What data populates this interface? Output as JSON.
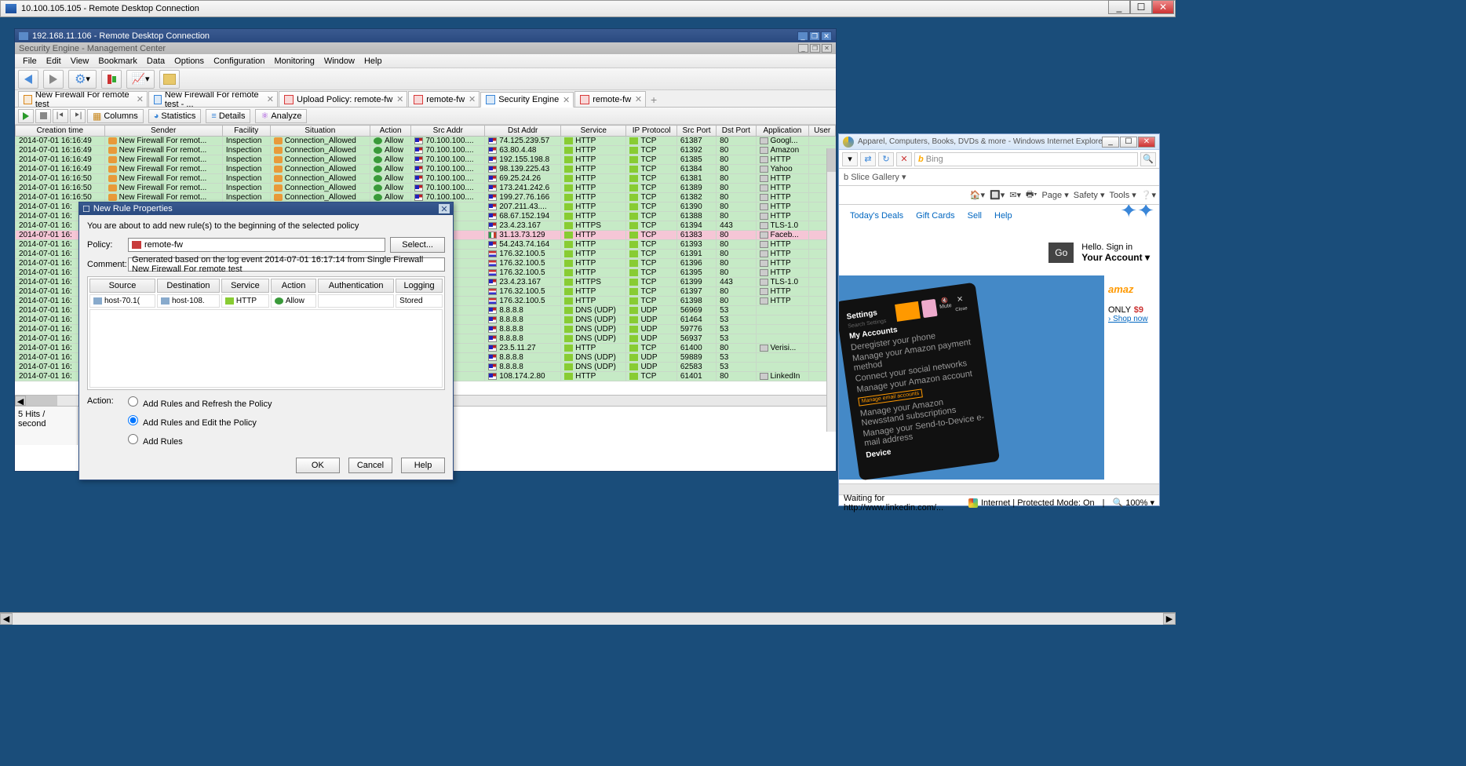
{
  "outer_rdp": {
    "title": "10.100.105.105 - Remote Desktop Connection"
  },
  "inner_rdp": {
    "title": "192.168.11.106 - Remote Desktop Connection"
  },
  "sec_win": {
    "title": "Security Engine - Management Center"
  },
  "menu": [
    "File",
    "Edit",
    "View",
    "Bookmark",
    "Data",
    "Options",
    "Configuration",
    "Monitoring",
    "Window",
    "Help"
  ],
  "tabs": [
    {
      "label": "New Firewall For remote test",
      "icon": "orange"
    },
    {
      "label": "New Firewall For remote test - ...",
      "icon": "blue"
    },
    {
      "label": "Upload Policy: remote-fw",
      "icon": "red"
    },
    {
      "label": "remote-fw",
      "icon": "red"
    },
    {
      "label": "Security Engine",
      "icon": "blue",
      "active": true
    },
    {
      "label": "remote-fw",
      "icon": "red"
    }
  ],
  "ctrl_buttons": {
    "columns": "Columns",
    "statistics": "Statistics",
    "details": "Details",
    "analyze": "Analyze"
  },
  "log_cols": [
    "Creation time",
    "Sender",
    "Facility",
    "Situation",
    "Action",
    "Src Addr",
    "Dst Addr",
    "Service",
    "IP Protocol",
    "Src Port",
    "Dst Port",
    "Application",
    "User"
  ],
  "log_rows": [
    {
      "t": "2014-07-01 16:16:49",
      "s": "New Firewall For remot...",
      "f": "Inspection",
      "sit": "Connection_Allowed",
      "a": "Allow",
      "src": "70.100.100....",
      "dst": "74.125.239.57",
      "svc": "HTTP",
      "p": "TCP",
      "sp": "61387",
      "dp": "80",
      "app": "Googl...",
      "cls": "allow",
      "df": "us"
    },
    {
      "t": "2014-07-01 16:16:49",
      "s": "New Firewall For remot...",
      "f": "Inspection",
      "sit": "Connection_Allowed",
      "a": "Allow",
      "src": "70.100.100....",
      "dst": "63.80.4.48",
      "svc": "HTTP",
      "p": "TCP",
      "sp": "61392",
      "dp": "80",
      "app": "Amazon",
      "cls": "allow",
      "df": "us"
    },
    {
      "t": "2014-07-01 16:16:49",
      "s": "New Firewall For remot...",
      "f": "Inspection",
      "sit": "Connection_Allowed",
      "a": "Allow",
      "src": "70.100.100....",
      "dst": "192.155.198.8",
      "svc": "HTTP",
      "p": "TCP",
      "sp": "61385",
      "dp": "80",
      "app": "HTTP",
      "cls": "allow",
      "df": "us"
    },
    {
      "t": "2014-07-01 16:16:49",
      "s": "New Firewall For remot...",
      "f": "Inspection",
      "sit": "Connection_Allowed",
      "a": "Allow",
      "src": "70.100.100....",
      "dst": "98.139.225.43",
      "svc": "HTTP",
      "p": "TCP",
      "sp": "61384",
      "dp": "80",
      "app": "Yahoo",
      "cls": "allow",
      "df": "us"
    },
    {
      "t": "2014-07-01 16:16:50",
      "s": "New Firewall For remot...",
      "f": "Inspection",
      "sit": "Connection_Allowed",
      "a": "Allow",
      "src": "70.100.100....",
      "dst": "69.25.24.26",
      "svc": "HTTP",
      "p": "TCP",
      "sp": "61381",
      "dp": "80",
      "app": "HTTP",
      "cls": "allow",
      "df": "us"
    },
    {
      "t": "2014-07-01 16:16:50",
      "s": "New Firewall For remot...",
      "f": "Inspection",
      "sit": "Connection_Allowed",
      "a": "Allow",
      "src": "70.100.100....",
      "dst": "173.241.242.6",
      "svc": "HTTP",
      "p": "TCP",
      "sp": "61389",
      "dp": "80",
      "app": "HTTP",
      "cls": "allow",
      "df": "us"
    },
    {
      "t": "2014-07-01 16:16:50",
      "s": "New Firewall For remot...",
      "f": "Inspection",
      "sit": "Connection_Allowed",
      "a": "Allow",
      "src": "70.100.100....",
      "dst": "199.27.76.166",
      "svc": "HTTP",
      "p": "TCP",
      "sp": "61382",
      "dp": "80",
      "app": "HTTP",
      "cls": "allow",
      "df": "us"
    },
    {
      "t": "2014-07-01 16:",
      "s": "",
      "f": "",
      "sit": "",
      "a": "",
      "src": "100....",
      "dst": "207.211.43....",
      "svc": "HTTP",
      "p": "TCP",
      "sp": "61390",
      "dp": "80",
      "app": "HTTP",
      "cls": "allow",
      "df": "us"
    },
    {
      "t": "2014-07-01 16:",
      "s": "",
      "f": "",
      "sit": "",
      "a": "",
      "src": "100....",
      "dst": "68.67.152.194",
      "svc": "HTTP",
      "p": "TCP",
      "sp": "61388",
      "dp": "80",
      "app": "HTTP",
      "cls": "allow",
      "df": "us"
    },
    {
      "t": "2014-07-01 16:",
      "s": "",
      "f": "",
      "sit": "",
      "a": "",
      "src": "100....",
      "dst": "23.4.23.167",
      "svc": "HTTPS",
      "p": "TCP",
      "sp": "61394",
      "dp": "443",
      "app": "TLS-1.0",
      "cls": "allow",
      "df": "us"
    },
    {
      "t": "2014-07-01 16:",
      "s": "",
      "f": "",
      "sit": "",
      "a": "",
      "src": "100....",
      "dst": "31.13.73.129",
      "svc": "HTTP",
      "p": "TCP",
      "sp": "61383",
      "dp": "80",
      "app": "Faceb...",
      "cls": "sel",
      "df": "it"
    },
    {
      "t": "2014-07-01 16:",
      "s": "",
      "f": "",
      "sit": "",
      "a": "",
      "src": "100....",
      "dst": "54.243.74.164",
      "svc": "HTTP",
      "p": "TCP",
      "sp": "61393",
      "dp": "80",
      "app": "HTTP",
      "cls": "allow",
      "df": "us"
    },
    {
      "t": "2014-07-01 16:",
      "s": "",
      "f": "",
      "sit": "",
      "a": "",
      "src": "100....",
      "dst": "176.32.100.5",
      "svc": "HTTP",
      "p": "TCP",
      "sp": "61391",
      "dp": "80",
      "app": "HTTP",
      "cls": "allow",
      "df": "nl"
    },
    {
      "t": "2014-07-01 16:",
      "s": "",
      "f": "",
      "sit": "",
      "a": "",
      "src": "100....",
      "dst": "176.32.100.5",
      "svc": "HTTP",
      "p": "TCP",
      "sp": "61396",
      "dp": "80",
      "app": "HTTP",
      "cls": "allow",
      "df": "nl"
    },
    {
      "t": "2014-07-01 16:",
      "s": "",
      "f": "",
      "sit": "",
      "a": "",
      "src": "100....",
      "dst": "176.32.100.5",
      "svc": "HTTP",
      "p": "TCP",
      "sp": "61395",
      "dp": "80",
      "app": "HTTP",
      "cls": "allow",
      "df": "nl"
    },
    {
      "t": "2014-07-01 16:",
      "s": "",
      "f": "",
      "sit": "",
      "a": "",
      "src": "100....",
      "dst": "23.4.23.167",
      "svc": "HTTPS",
      "p": "TCP",
      "sp": "61399",
      "dp": "443",
      "app": "TLS-1.0",
      "cls": "allow",
      "df": "us"
    },
    {
      "t": "2014-07-01 16:",
      "s": "",
      "f": "",
      "sit": "",
      "a": "",
      "src": "100....",
      "dst": "176.32.100.5",
      "svc": "HTTP",
      "p": "TCP",
      "sp": "61397",
      "dp": "80",
      "app": "HTTP",
      "cls": "allow",
      "df": "nl"
    },
    {
      "t": "2014-07-01 16:",
      "s": "",
      "f": "",
      "sit": "",
      "a": "",
      "src": "100....",
      "dst": "176.32.100.5",
      "svc": "HTTP",
      "p": "TCP",
      "sp": "61398",
      "dp": "80",
      "app": "HTTP",
      "cls": "allow",
      "df": "nl"
    },
    {
      "t": "2014-07-01 16:",
      "s": "",
      "f": "",
      "sit": "",
      "a": "",
      "src": "100....",
      "dst": "8.8.8.8",
      "svc": "DNS (UDP)",
      "p": "UDP",
      "sp": "56969",
      "dp": "53",
      "app": "",
      "cls": "allow",
      "df": "us"
    },
    {
      "t": "2014-07-01 16:",
      "s": "",
      "f": "",
      "sit": "",
      "a": "",
      "src": "100....",
      "dst": "8.8.8.8",
      "svc": "DNS (UDP)",
      "p": "UDP",
      "sp": "61464",
      "dp": "53",
      "app": "",
      "cls": "allow",
      "df": "us"
    },
    {
      "t": "2014-07-01 16:",
      "s": "",
      "f": "",
      "sit": "",
      "a": "",
      "src": "100....",
      "dst": "8.8.8.8",
      "svc": "DNS (UDP)",
      "p": "UDP",
      "sp": "59776",
      "dp": "53",
      "app": "",
      "cls": "allow",
      "df": "us"
    },
    {
      "t": "2014-07-01 16:",
      "s": "",
      "f": "",
      "sit": "",
      "a": "",
      "src": "100....",
      "dst": "8.8.8.8",
      "svc": "DNS (UDP)",
      "p": "UDP",
      "sp": "56937",
      "dp": "53",
      "app": "",
      "cls": "allow",
      "df": "us"
    },
    {
      "t": "2014-07-01 16:",
      "s": "",
      "f": "",
      "sit": "",
      "a": "",
      "src": "100....",
      "dst": "23.5.11.27",
      "svc": "HTTP",
      "p": "TCP",
      "sp": "61400",
      "dp": "80",
      "app": "Verisi...",
      "cls": "allow",
      "df": "us"
    },
    {
      "t": "2014-07-01 16:",
      "s": "",
      "f": "",
      "sit": "",
      "a": "",
      "src": "100....",
      "dst": "8.8.8.8",
      "svc": "DNS (UDP)",
      "p": "UDP",
      "sp": "59889",
      "dp": "53",
      "app": "",
      "cls": "allow",
      "df": "us"
    },
    {
      "t": "2014-07-01 16:",
      "s": "",
      "f": "",
      "sit": "",
      "a": "",
      "src": "100....",
      "dst": "8.8.8.8",
      "svc": "DNS (UDP)",
      "p": "UDP",
      "sp": "62583",
      "dp": "53",
      "app": "",
      "cls": "allow",
      "df": "us"
    },
    {
      "t": "2014-07-01 16:",
      "s": "",
      "f": "",
      "sit": "",
      "a": "",
      "src": "100....",
      "dst": "108.174.2.80",
      "svc": "HTTP",
      "p": "TCP",
      "sp": "61401",
      "dp": "80",
      "app": "LinkedIn",
      "cls": "allow",
      "df": "us"
    }
  ],
  "hits": {
    "label": "Hits / second",
    "val": "5"
  },
  "dialog": {
    "title": "New Rule Properties",
    "msg": "You are about to add new rule(s) to the beginning of the selected policy",
    "policy_label": "Policy:",
    "policy_value": "remote-fw",
    "select_btn": "Select...",
    "comment_label": "Comment:",
    "comment_value": "Generated based on the log event 2014-07-01 16:17:14 from Single Firewall New Firewall For remote test",
    "cols": [
      "Source",
      "Destination",
      "Service",
      "Action",
      "Authentication",
      "Logging"
    ],
    "row": {
      "src": "host-70.1(",
      "dst": "host-108.",
      "svc": "HTTP",
      "act": "Allow",
      "auth": "",
      "log": "Stored"
    },
    "action_label": "Action:",
    "r1": "Add Rules and Refresh the Policy",
    "r2": "Add Rules and Edit the Policy",
    "r3": "Add Rules",
    "ok": "OK",
    "cancel": "Cancel",
    "help": "Help"
  },
  "ie": {
    "title": "Apparel, Computers, Books, DVDs & more - Windows Internet Explorer",
    "search_placeholder": "Bing",
    "favbar": "Slice Gallery ▾",
    "cmds": [
      "Page ▾",
      "Safety ▾",
      "Tools ▾"
    ],
    "amz_nav": [
      "Today's Deals",
      "Gift Cards",
      "Sell",
      "Help"
    ],
    "go": "Go",
    "signin1": "Hello. Sign in",
    "signin2": "Your Account ▾",
    "phone": {
      "title1": "Settings",
      "title2": "My Accounts",
      "items": [
        "Deregister your phone",
        "Manage your Amazon payment method",
        "Connect your social networks",
        "Manage your Amazon account",
        "Manage email accounts",
        "Manage your Amazon Newsstand subscriptions",
        "Manage your Send-to-Device e-mail address"
      ],
      "title3": "Device"
    },
    "logo": "amaz",
    "only": "ONLY",
    "price": "$9",
    "shop": "› Shop now",
    "status1": "Waiting for http://www.linkedin.com/...",
    "status2": "Internet | Protected Mode: On",
    "zoom": "100%"
  }
}
